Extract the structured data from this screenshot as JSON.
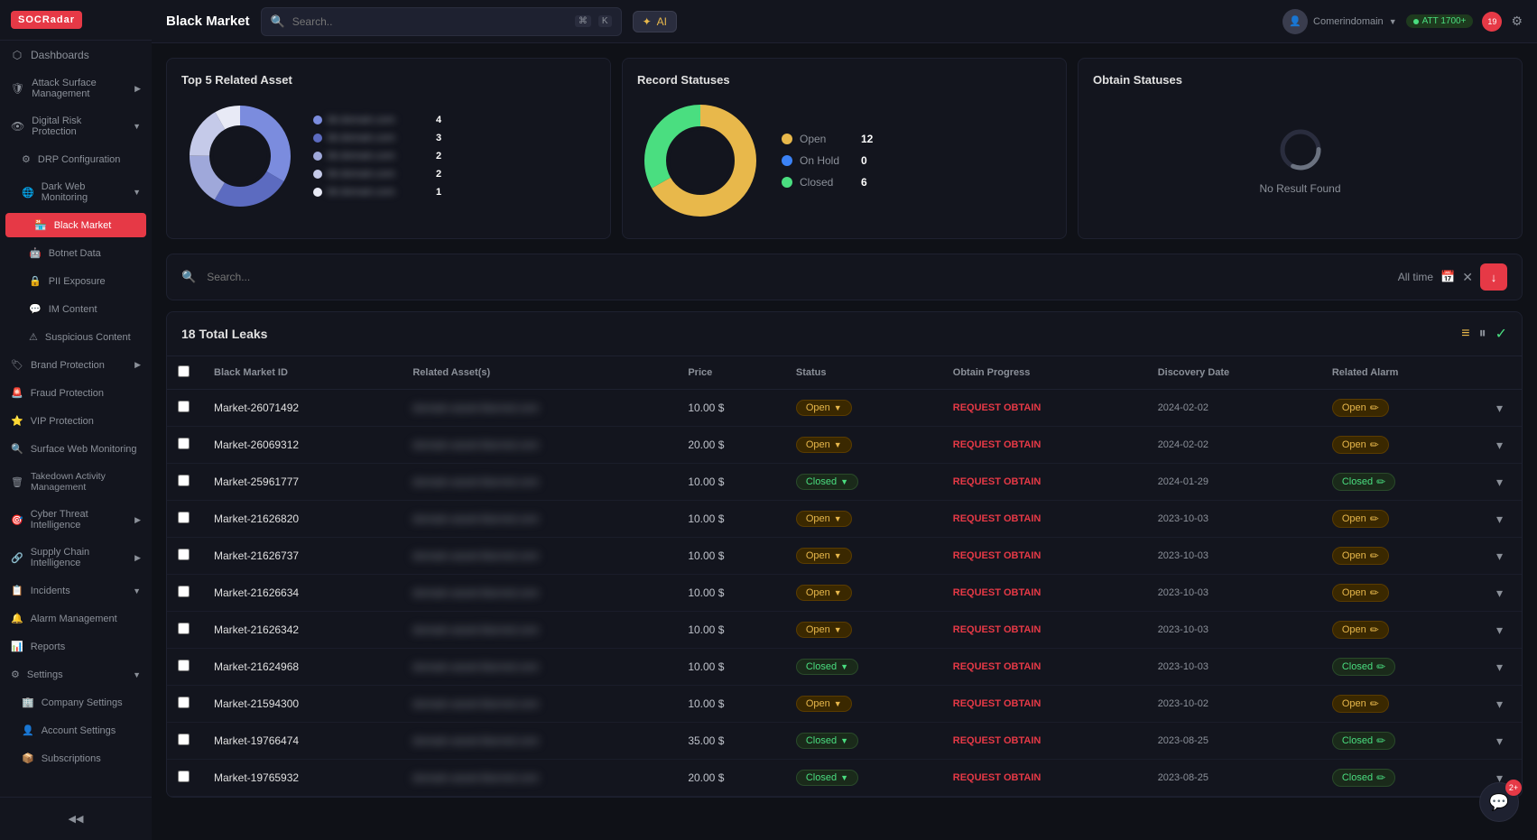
{
  "app": {
    "logo": "SOCRadar",
    "page_title": "Black Market"
  },
  "topbar": {
    "title": "Black Market",
    "search_placeholder": "Search..",
    "kbd1": "⌘",
    "kbd2": "K",
    "ai_label": "AI",
    "user_name": "Comerindomain",
    "status_text": "ATT 1700+",
    "notif_count": "19"
  },
  "sidebar": {
    "items": [
      {
        "id": "dashboards",
        "label": "Dashboards",
        "icon": "grid-icon",
        "indent": 0
      },
      {
        "id": "attack-surface",
        "label": "Attack Surface Management",
        "icon": "shield-icon",
        "indent": 0,
        "has_children": true
      },
      {
        "id": "digital-risk",
        "label": "Digital Risk Protection",
        "icon": "eye-icon",
        "indent": 0,
        "has_children": true
      },
      {
        "id": "drp-config",
        "label": "DRP Configuration",
        "icon": "settings-icon",
        "indent": 1
      },
      {
        "id": "dark-web",
        "label": "Dark Web Monitoring",
        "icon": "web-icon",
        "indent": 1,
        "has_children": true
      },
      {
        "id": "black-market",
        "label": "Black Market",
        "icon": "market-icon",
        "indent": 2,
        "active": true
      },
      {
        "id": "botnet-data",
        "label": "Botnet Data",
        "icon": "botnet-icon",
        "indent": 2
      },
      {
        "id": "pii-exposure",
        "label": "PII Exposure",
        "icon": "pii-icon",
        "indent": 2
      },
      {
        "id": "im-content",
        "label": "IM Content",
        "icon": "im-icon",
        "indent": 2
      },
      {
        "id": "suspicious-content",
        "label": "Suspicious Content",
        "icon": "suspicious-icon",
        "indent": 2
      },
      {
        "id": "brand-protection",
        "label": "Brand Protection",
        "icon": "brand-icon",
        "indent": 0,
        "has_children": true
      },
      {
        "id": "fraud-protection",
        "label": "Fraud Protection",
        "icon": "fraud-icon",
        "indent": 0
      },
      {
        "id": "vip-protection",
        "label": "VIP Protection",
        "icon": "vip-icon",
        "indent": 0
      },
      {
        "id": "surface-web",
        "label": "Surface Web Monitoring",
        "icon": "surface-icon",
        "indent": 0
      },
      {
        "id": "takedown",
        "label": "Takedown Activity Management",
        "icon": "takedown-icon",
        "indent": 0
      },
      {
        "id": "cyber-threat",
        "label": "Cyber Threat Intelligence",
        "icon": "threat-icon",
        "indent": 0,
        "has_children": true
      },
      {
        "id": "supply-chain",
        "label": "Supply Chain Intelligence",
        "icon": "chain-icon",
        "indent": 0,
        "has_children": true
      },
      {
        "id": "incidents",
        "label": "Incidents",
        "icon": "incident-icon",
        "indent": 0,
        "has_children": true
      },
      {
        "id": "alarm-management",
        "label": "Alarm Management",
        "icon": "alarm-icon",
        "indent": 0
      },
      {
        "id": "reports",
        "label": "Reports",
        "icon": "reports-icon",
        "indent": 0
      },
      {
        "id": "settings",
        "label": "Settings",
        "icon": "settings2-icon",
        "indent": 0,
        "has_children": true
      },
      {
        "id": "company-settings",
        "label": "Company Settings",
        "icon": "company-icon",
        "indent": 1
      },
      {
        "id": "account-settings",
        "label": "Account Settings",
        "icon": "account-icon",
        "indent": 1
      },
      {
        "id": "subscriptions",
        "label": "Subscriptions",
        "icon": "sub-icon",
        "indent": 1
      }
    ]
  },
  "charts": {
    "top5": {
      "title": "Top 5 Related Asset",
      "segments": [
        {
          "color": "#7b8cde",
          "label": "asset-1",
          "value": 4
        },
        {
          "color": "#5c6bc0",
          "label": "asset-2",
          "value": 3
        },
        {
          "color": "#9fa8da",
          "label": "asset-3",
          "value": 2
        },
        {
          "color": "#c5cae9",
          "label": "asset-4",
          "value": 2
        },
        {
          "color": "#e8eaf6",
          "label": "asset-5",
          "value": 1
        }
      ]
    },
    "record_statuses": {
      "title": "Record Statuses",
      "segments": [
        {
          "color": "#e8b84b",
          "label": "Open",
          "value": 12
        },
        {
          "color": "#3b82f6",
          "label": "On Hold",
          "value": 0
        },
        {
          "color": "#4ade80",
          "label": "Closed",
          "value": 6
        }
      ]
    },
    "obtain_statuses": {
      "title": "Obtain Statuses",
      "no_result": "No Result Found"
    }
  },
  "filter": {
    "search_placeholder": "Search...",
    "time_label": "All time"
  },
  "table": {
    "total_leaks": "18 Total Leaks",
    "columns": [
      "",
      "Black Market ID",
      "Related Asset(s)",
      "Price",
      "Status",
      "Obtain Progress",
      "Discovery Date",
      "Related Alarm",
      ""
    ],
    "rows": [
      {
        "id": "Market-26071492",
        "asset": "blurred-asset-1",
        "price": "10.00 $",
        "status": "Open",
        "obtain": "REQUEST OBTAIN",
        "date": "2024-02-02",
        "alarm": "Open"
      },
      {
        "id": "Market-26069312",
        "asset": "blurred-asset-2",
        "price": "20.00 $",
        "status": "Open",
        "obtain": "REQUEST OBTAIN",
        "date": "2024-02-02",
        "alarm": "Open"
      },
      {
        "id": "Market-25961777",
        "asset": "blurred-asset-3",
        "price": "10.00 $",
        "status": "Closed",
        "obtain": "REQUEST OBTAIN",
        "date": "2024-01-29",
        "alarm": "Closed"
      },
      {
        "id": "Market-21626820",
        "asset": "blurred-asset-4",
        "price": "10.00 $",
        "status": "Open",
        "obtain": "REQUEST OBTAIN",
        "date": "2023-10-03",
        "alarm": "Open"
      },
      {
        "id": "Market-21626737",
        "asset": "blurred-asset-5",
        "price": "10.00 $",
        "status": "Open",
        "obtain": "REQUEST OBTAIN",
        "date": "2023-10-03",
        "alarm": "Open"
      },
      {
        "id": "Market-21626634",
        "asset": "blurred-asset-6",
        "price": "10.00 $",
        "status": "Open",
        "obtain": "REQUEST OBTAIN",
        "date": "2023-10-03",
        "alarm": "Open"
      },
      {
        "id": "Market-21626342",
        "asset": "blurred-asset-7",
        "price": "10.00 $",
        "status": "Open",
        "obtain": "REQUEST OBTAIN",
        "date": "2023-10-03",
        "alarm": "Open"
      },
      {
        "id": "Market-21624968",
        "asset": "blurred-asset-8",
        "price": "10.00 $",
        "status": "Closed",
        "obtain": "REQUEST OBTAIN",
        "date": "2023-10-03",
        "alarm": "Closed"
      },
      {
        "id": "Market-21594300",
        "asset": "blurred-asset-9",
        "price": "10.00 $",
        "status": "Open",
        "obtain": "REQUEST OBTAIN",
        "date": "2023-10-02",
        "alarm": "Open"
      },
      {
        "id": "Market-19766474",
        "asset": "blurred-asset-10",
        "price": "35.00 $",
        "status": "Closed",
        "obtain": "REQUEST OBTAIN",
        "date": "2023-08-25",
        "alarm": "Closed"
      },
      {
        "id": "Market-19765932",
        "asset": "blurred-asset-11",
        "price": "20.00 $",
        "status": "Closed",
        "obtain": "REQUEST OBTAIN",
        "date": "2023-08-25",
        "alarm": "Closed"
      }
    ]
  },
  "chat": {
    "badge": "2+"
  }
}
